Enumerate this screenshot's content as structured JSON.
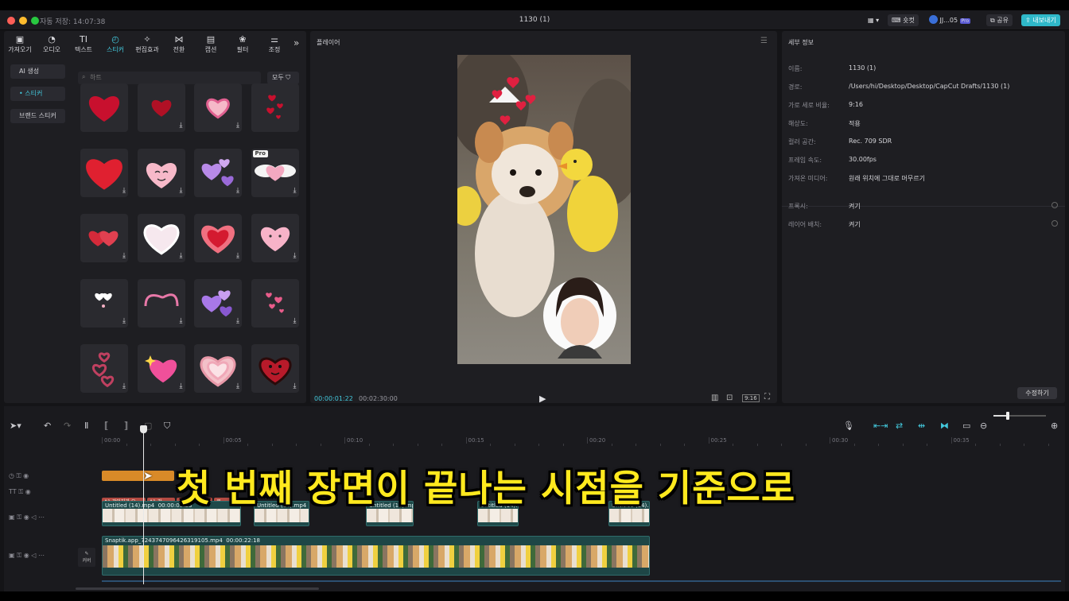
{
  "titlebar": {
    "saved_text": "자동 저장: 14:07:38",
    "project_title": "1130 (1)",
    "shortcut_label": "숏컷",
    "user_label": "JJ...05",
    "user_badge": "Pro",
    "share_label": "공유",
    "export_label": "내보내기"
  },
  "toolbar": {
    "items": [
      {
        "label": "가져오기",
        "icon": "import-icon"
      },
      {
        "label": "오디오",
        "icon": "audio-icon"
      },
      {
        "label": "텍스트",
        "icon": "text-icon"
      },
      {
        "label": "스티커",
        "icon": "sticker-icon"
      },
      {
        "label": "편집효과",
        "icon": "effects-icon"
      },
      {
        "label": "전환",
        "icon": "transition-icon"
      },
      {
        "label": "캡션",
        "icon": "caption-icon"
      },
      {
        "label": "필터",
        "icon": "filter-icon"
      },
      {
        "label": "조정",
        "icon": "adjust-icon"
      }
    ],
    "active": "스티커"
  },
  "sidebar": {
    "items": [
      {
        "label": "AI 생성"
      },
      {
        "label": "• 스티커"
      },
      {
        "label": "브랜드 스티커"
      }
    ]
  },
  "sticker_panel": {
    "search_placeholder": "하트",
    "filter_label": "모두",
    "pro_badge": "Pro",
    "download_glyph": "⤓"
  },
  "player": {
    "title": "플레이어",
    "current_time": "00:00:01:22",
    "total_time": "00:02:30:00",
    "ratio_label": "9:16"
  },
  "details": {
    "title": "세부 정보",
    "rows": [
      {
        "label": "이름:",
        "value": "1130 (1)"
      },
      {
        "label": "경로:",
        "value": "/Users/hi/Desktop/Desktop/CapCut Drafts/1130 (1)"
      },
      {
        "label": "가로 세로 비율:",
        "value": "9:16"
      },
      {
        "label": "해상도:",
        "value": "적용"
      },
      {
        "label": "컬러 공간:",
        "value": "Rec. 709 SDR"
      },
      {
        "label": "프레임 속도:",
        "value": "30.00fps"
      },
      {
        "label": "가져온 미디어:",
        "value": "원래 위치에 그대로 머무르기"
      }
    ],
    "rows2": [
      {
        "label": "프록시:",
        "value": "켜기"
      },
      {
        "label": "레이어 배치:",
        "value": "켜기"
      }
    ],
    "modify_button": "수정하기"
  },
  "timeline": {
    "ruler": [
      "00:00",
      "00:05",
      "00:10",
      "00:15",
      "00:20",
      "00:25",
      "00:30",
      "00:35"
    ],
    "text_clips": [
      "A1 강아지가 오...",
      "A1 강..",
      "A1 ...",
      "로 ..."
    ],
    "overlay_clips": [
      {
        "label": "Untitled (14).mp4",
        "duration": "00:00:05:23"
      },
      {
        "label": "Untitled (14).mp4"
      },
      {
        "label": "Untitled (14).mp"
      },
      {
        "label": "Untitled (14).r"
      },
      {
        "label": "Untitled (14).r"
      }
    ],
    "main_clip": {
      "label": "Snaptik.app_7243747096426319105.mp4",
      "duration": "00:00:22:18"
    },
    "cover_label": "커버"
  },
  "subtitle": "첫 번째 장면이 끝나는 시점을 기준으로",
  "colors": {
    "accent": "#43c8dc",
    "export": "#2fb8c9",
    "subtitle": "#ffe91e"
  }
}
